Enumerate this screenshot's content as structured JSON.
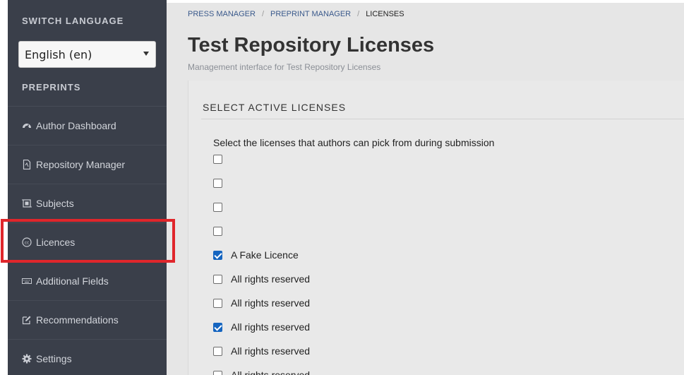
{
  "sidebar": {
    "switch_language_title": "SWITCH LANGUAGE",
    "language_selected": "English (en)",
    "preprints_title": "PREPRINTS",
    "items": [
      {
        "label": "Author Dashboard",
        "icon": "dashboard-icon"
      },
      {
        "label": "Repository Manager",
        "icon": "file-icon"
      },
      {
        "label": "Subjects",
        "icon": "subjects-icon"
      },
      {
        "label": "Licences",
        "icon": "cc-icon"
      },
      {
        "label": "Additional Fields",
        "icon": "keyboard-icon"
      },
      {
        "label": "Recommendations",
        "icon": "edit-icon"
      },
      {
        "label": "Settings",
        "icon": "gear-icon"
      }
    ]
  },
  "breadcrumb": {
    "items": [
      "PRESS MANAGER",
      "PREPRINT MANAGER"
    ],
    "current": "LICENSES"
  },
  "page": {
    "title": "Test Repository Licenses",
    "subtitle": "Management interface for Test Repository Licenses"
  },
  "panel": {
    "heading": "SELECT ACTIVE LICENSES",
    "intro": "Select the licenses that authors can pick from during submission",
    "licenses": [
      {
        "label": "",
        "checked": false
      },
      {
        "label": "",
        "checked": false
      },
      {
        "label": "",
        "checked": false
      },
      {
        "label": "",
        "checked": false
      },
      {
        "label": "A Fake Licence",
        "checked": true
      },
      {
        "label": "All rights reserved",
        "checked": false
      },
      {
        "label": "All rights reserved",
        "checked": false
      },
      {
        "label": "All rights reserved",
        "checked": true
      },
      {
        "label": "All rights reserved",
        "checked": false
      },
      {
        "label": "All rights reserved",
        "checked": false
      }
    ]
  },
  "colors": {
    "sidebar_bg": "#3a3f4a",
    "highlight": "#e0262b",
    "checkbox_checked": "#1565c0",
    "link": "#3b5a8c"
  }
}
